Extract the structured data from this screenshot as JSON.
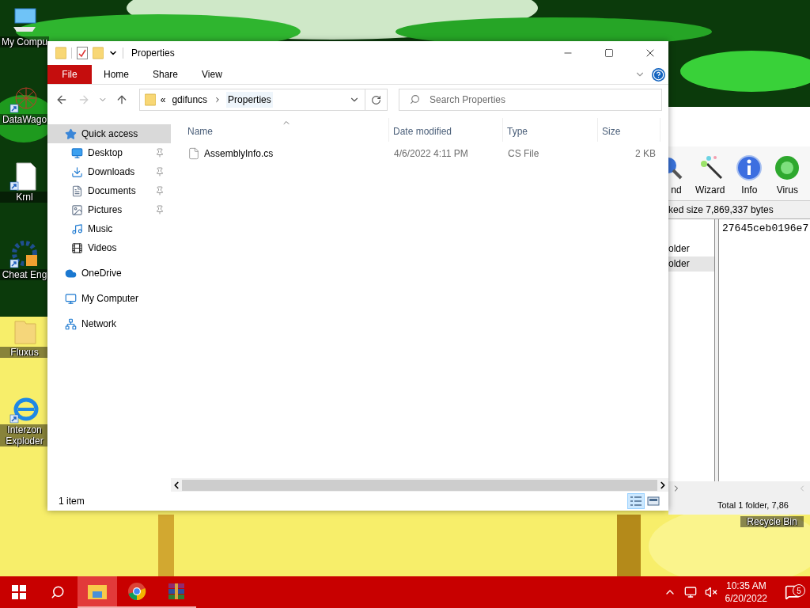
{
  "desktop_icons": [
    {
      "label": "My Compu",
      "kind": "computer",
      "shortcut": false
    },
    {
      "label": "DataWago",
      "kind": "web",
      "shortcut": true
    },
    {
      "label": "Krnl",
      "kind": "file",
      "shortcut": true
    },
    {
      "label": "Cheat Eng",
      "kind": "gear",
      "shortcut": true
    },
    {
      "label": "Fluxus",
      "kind": "folder",
      "shortcut": false
    },
    {
      "label": "Interzon Exploder",
      "kind": "browser",
      "shortcut": true
    }
  ],
  "recycle_bin": {
    "label": "Recycle Bin"
  },
  "background_window": {
    "toolbar": [
      {
        "label": "nd",
        "kind": "find"
      },
      {
        "label": "Wizard",
        "kind": "wizard"
      },
      {
        "label": "Info",
        "kind": "info"
      },
      {
        "label": "Virus",
        "kind": "virus"
      }
    ],
    "info_bar": "ked size 7,869,337 bytes",
    "tree": [
      {
        "label": "older",
        "selected": false
      },
      {
        "label": "older",
        "selected": true
      }
    ],
    "file_text": "27645ceb0196e7",
    "status": "Total 1 folder, 7,86"
  },
  "explorer": {
    "title": "Properties",
    "ribbon_tabs": [
      {
        "label": "File",
        "selected": true
      },
      {
        "label": "Home",
        "selected": false
      },
      {
        "label": "Share",
        "selected": false
      },
      {
        "label": "View",
        "selected": false
      }
    ],
    "address": {
      "overflow": "«",
      "path": [
        "gdifuncs",
        "Properties"
      ]
    },
    "search": {
      "placeholder": "Search Properties"
    },
    "sidebar": [
      {
        "label": "Quick access",
        "kind": "star",
        "selected": true,
        "pinned": false,
        "children": [
          {
            "label": "Desktop",
            "kind": "desktop",
            "selected": false,
            "pinned": true
          },
          {
            "label": "Downloads",
            "kind": "downloads",
            "selected": false,
            "pinned": true
          },
          {
            "label": "Documents",
            "kind": "documents",
            "selected": false,
            "pinned": true
          },
          {
            "label": "Pictures",
            "kind": "pictures",
            "selected": false,
            "pinned": true
          },
          {
            "label": "Music",
            "kind": "music",
            "selected": false,
            "pinned": false
          },
          {
            "label": "Videos",
            "kind": "videos",
            "selected": false,
            "pinned": false
          }
        ]
      },
      {
        "label": "OneDrive",
        "kind": "cloud",
        "selected": false,
        "pinned": false
      },
      {
        "label": "My Computer",
        "kind": "computer",
        "selected": false,
        "pinned": false
      },
      {
        "label": "Network",
        "kind": "network",
        "selected": false,
        "pinned": false
      }
    ],
    "columns": [
      {
        "label": "Name",
        "sorted": true
      },
      {
        "label": "Date modified",
        "sorted": false
      },
      {
        "label": "Type",
        "sorted": false
      },
      {
        "label": "Size",
        "sorted": false
      }
    ],
    "rows": [
      {
        "name": "AssemblyInfo.cs",
        "date": "4/6/2022 4:11 PM",
        "type": "CS File",
        "size": "2 KB"
      }
    ],
    "status": "1 item",
    "views": [
      {
        "kind": "details",
        "selected": true
      },
      {
        "kind": "large",
        "selected": false
      }
    ]
  },
  "taskbar": {
    "apps": [
      {
        "kind": "explorer",
        "selected": true
      },
      {
        "kind": "chrome",
        "selected": false
      },
      {
        "kind": "archive",
        "selected": false
      }
    ],
    "time": "10:35 AM",
    "date": "6/20/2022",
    "notifications": "5"
  }
}
